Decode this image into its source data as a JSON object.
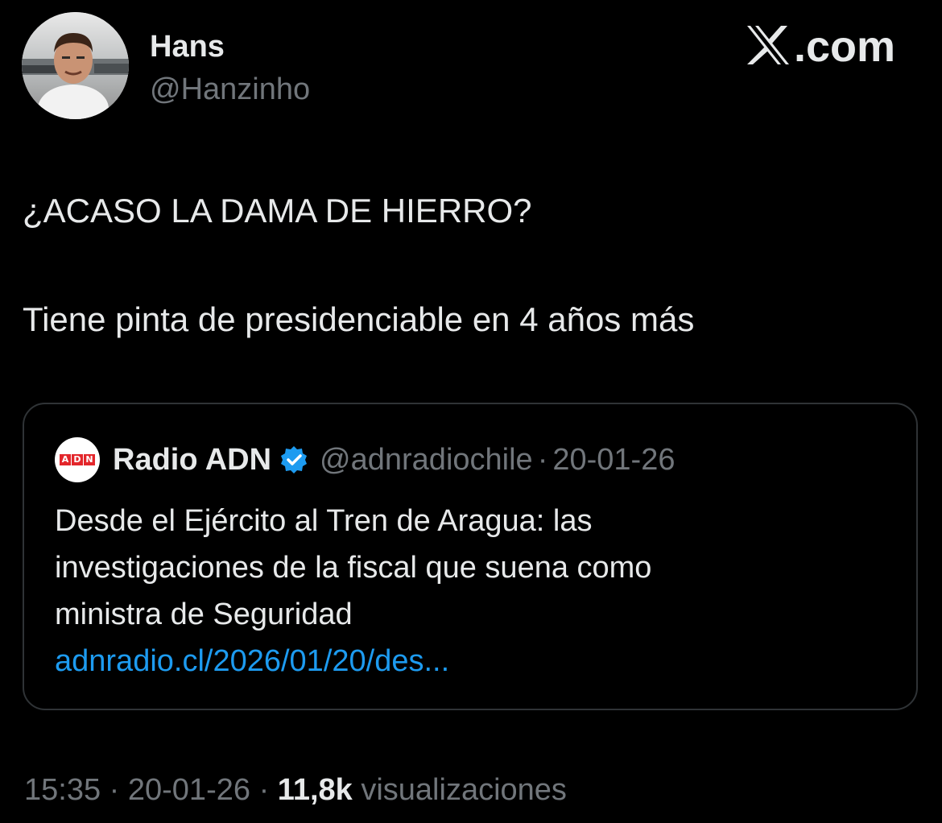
{
  "author": {
    "display_name": "Hans",
    "handle": "@Hanzinho"
  },
  "site": {
    "logo_text": ".com",
    "logo_icon": "x-logo-icon"
  },
  "tweet": {
    "line1": "¿ACASO LA DAMA DE HIERRO?",
    "line2": "Tiene pinta de presidenciable en 4 años más"
  },
  "quoted_tweet": {
    "avatar_letters": [
      "A",
      "D",
      "N"
    ],
    "name": "Radio ADN",
    "verified_icon": "verified-badge-icon",
    "handle": "@adnradiochile",
    "separator": "·",
    "date": "20-01-26",
    "text_lines": [
      "Desde el Ejército al Tren de Aragua: las",
      "investigaciones de la fiscal que suena como",
      "ministra de Seguridad"
    ],
    "link": "adnradio.cl/2026/01/20/des..."
  },
  "meta": {
    "time": "15:35",
    "separator": "·",
    "date": "20-01-26",
    "views_count": "11,8k",
    "views_label": "visualizaciones"
  },
  "colors": {
    "background": "#000000",
    "text_primary": "#e7e9ea",
    "text_secondary": "#71767b",
    "link": "#1d9bf0",
    "verified": "#1d9bf0",
    "card_border": "#2f3336",
    "adn_red": "#e3262b"
  }
}
